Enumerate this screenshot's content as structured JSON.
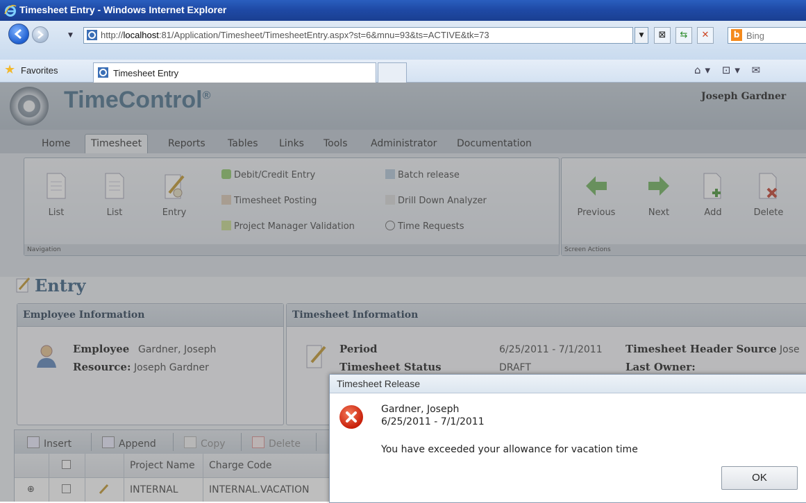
{
  "browser": {
    "window_title": "Timesheet Entry - Windows Internet Explorer",
    "url_prefix": "http://",
    "url_host": "localhost",
    "url_rest": ":81/Application/Timesheet/TimesheetEntry.aspx?st=6&mnu=93&ts=ACTIVE&tk=73",
    "search_provider": "Bing",
    "favorites_label": "Favorites",
    "tab_title": "Timesheet Entry"
  },
  "app": {
    "brand": "TimeControl",
    "brand_mark": "®",
    "user_name": "Joseph Gardner",
    "menu": [
      "Home",
      "Timesheet",
      "Reports",
      "Tables",
      "Links",
      "Tools",
      "Administrator",
      "Documentation"
    ],
    "active_menu": "Timesheet",
    "ribbon": {
      "navigation_group_label": "Navigation",
      "nav_buttons": [
        "List",
        "List",
        "Entry"
      ],
      "links_col1": [
        "Debit/Credit Entry",
        "Timesheet Posting",
        "Project Manager Validation"
      ],
      "links_col2": [
        "Batch release",
        "Drill Down Analyzer",
        "Time Requests"
      ],
      "screen_actions_group_label": "Screen Actions",
      "action_buttons": [
        "Previous",
        "Next",
        "Add",
        "Delete"
      ]
    },
    "page_title": "Entry",
    "employee_panel": {
      "title": "Employee Information",
      "employee_label": "Employee",
      "employee_value": "Gardner, Joseph",
      "resource_label": "Resource:",
      "resource_value": "Joseph Gardner"
    },
    "timesheet_panel": {
      "title": "Timesheet Information",
      "period_label": "Period",
      "period_value": "6/25/2011 - 7/1/2011",
      "header_source_label": "Timesheet Header Source",
      "header_source_value": "Jose",
      "status_label": "Timesheet Status",
      "status_value": "DRAFT",
      "last_owner_label": "Last Owner:"
    },
    "grid_toolbar": [
      "Insert",
      "Append",
      "Copy",
      "Delete"
    ],
    "grid": {
      "headers": [
        "Project Name",
        "Charge Code"
      ],
      "rows": [
        {
          "expand": "⊕",
          "project": "INTERNAL",
          "charge_code": "INTERNAL.VACATION"
        }
      ]
    }
  },
  "dialog": {
    "title": "Timesheet Release",
    "name": "Gardner, Joseph",
    "period": "6/25/2011 - 7/1/2011",
    "message": "You have exceeded your allowance for vacation time",
    "ok_label": "OK"
  },
  "colors": {
    "ie_title_bar": "#1f4aa6",
    "brand_text": "#5a7d96",
    "error_red": "#c8200a"
  }
}
